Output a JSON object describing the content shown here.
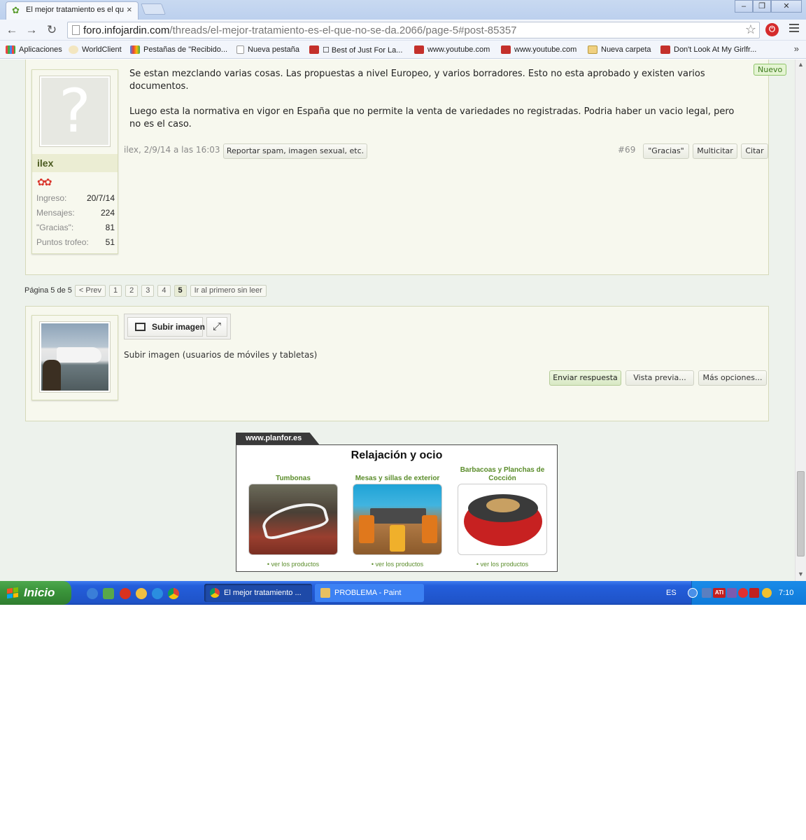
{
  "browser": {
    "tab_title": "El mejor tratamiento es el qu",
    "tab_close": "×",
    "url_host": "foro.infojardin.com",
    "url_path": "/threads/el-mejor-tratamiento-es-el-que-no-se-da.2066/page-5#post-85357",
    "window_buttons": [
      "–",
      "❐",
      "✕"
    ],
    "bookmarks": [
      {
        "label": "Aplicaciones",
        "icon": "apps-grid-icon"
      },
      {
        "label": "WorldClient",
        "icon": "worldclient-icon"
      },
      {
        "label": "Pestañas de \"Recibido...",
        "icon": "google-icon"
      },
      {
        "label": "Nueva pestaña",
        "icon": "page-icon"
      },
      {
        "label": "☐ Best of Just For La...",
        "icon": "youtube-icon"
      },
      {
        "label": "www.youtube.com",
        "icon": "youtube-icon"
      },
      {
        "label": "www.youtube.com",
        "icon": "youtube-icon"
      },
      {
        "label": "Nueva carpeta",
        "icon": "folder-icon"
      },
      {
        "label": "Don't Look At My Girlfr...",
        "icon": "youtube-icon"
      }
    ],
    "bookmarks_more": "»"
  },
  "post": {
    "badge_new": "Nuevo",
    "paragraphs": [
      "Se estan mezclando varias cosas. Las propuestas a nivel Europeo, y varios borradores. Esto no esta aprobado y existen varios documentos.",
      "Luego esta la normativa en vigor en España que no permite la venta de variedades no registradas. Podria haber un vacio legal, pero no es el caso."
    ],
    "meta": "ilex, 2/9/14 a las 16:03",
    "report_button": "Reportar spam, imagen sexual, etc.",
    "post_number": "#69",
    "thanks_button": "\"Gracias\"",
    "multiquote_button": "Multicitar",
    "quote_button": "Citar",
    "avatar_glyph": "?"
  },
  "user": {
    "name": "ilex",
    "flowers": "✿✿",
    "stats": [
      {
        "label": "Ingreso:",
        "value": "20/7/14"
      },
      {
        "label": "Mensajes:",
        "value": "224"
      },
      {
        "label": "\"Gracias\":",
        "value": "81"
      },
      {
        "label": "Puntos trofeo:",
        "value": "51"
      }
    ]
  },
  "pagination": {
    "label": "Página 5 de 5",
    "prev": "< Prev",
    "pages": [
      "1",
      "2",
      "3",
      "4",
      "5"
    ],
    "current": "5",
    "first_unread": "Ir al primero sin leer"
  },
  "reply": {
    "upload_image": "Subir imagen",
    "upload_mobile": "Subir imagen (usuarios de móviles y tabletas)",
    "send_button": "Enviar respuesta",
    "preview_button": "Vista previa...",
    "more_options_button": "Más opciones..."
  },
  "ad": {
    "tab": "www.planfor.es",
    "title": "Relajación y ocio",
    "items": [
      {
        "caption": "Tumbonas",
        "link": "• ver los productos"
      },
      {
        "caption": "Mesas y sillas de exterior",
        "link": "• ver los productos"
      },
      {
        "caption": "Barbacoas y Planchas de Cocción",
        "link": "• ver los productos"
      }
    ]
  },
  "taskbar": {
    "start_label": "Inicio",
    "tasks": [
      {
        "label": "El mejor tratamiento ...",
        "active": true
      },
      {
        "label": "PROBLEMA - Paint",
        "active": false
      }
    ],
    "language": "ES",
    "clock": "7:10",
    "tray_labels": [
      "ATI"
    ]
  },
  "colors": {
    "page_bg": "#edf2ec",
    "post_bg": "#f7f8ee",
    "accent_green": "#5a8c2a",
    "taskbar_blue": "#245edb"
  }
}
